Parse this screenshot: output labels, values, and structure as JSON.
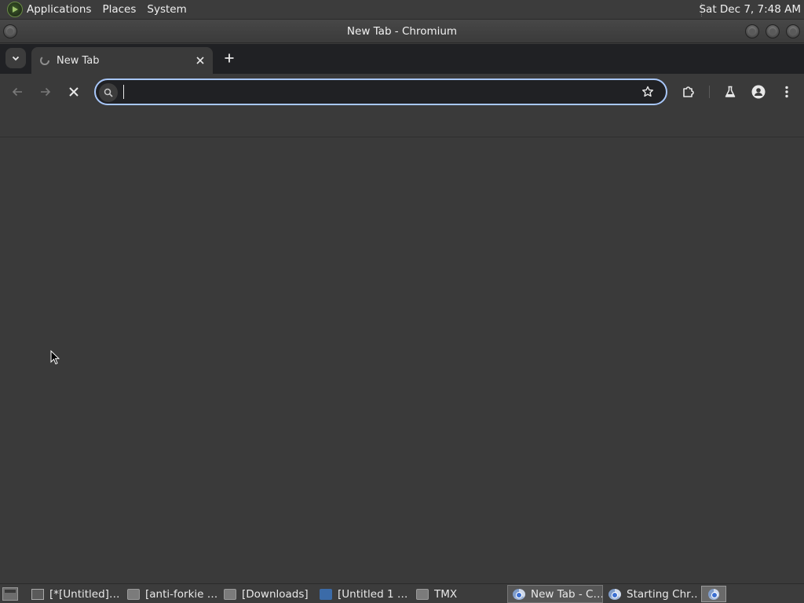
{
  "top_panel": {
    "menus": [
      "Applications",
      "Places",
      "System"
    ],
    "clock": "Sat Dec 7,  7:48 AM"
  },
  "window": {
    "title": "New Tab - Chromium"
  },
  "tabs": [
    {
      "title": "New Tab",
      "icon": "loading-favicon-icon"
    }
  ],
  "toolbar": {
    "omnibox_value": "",
    "icons": [
      "back-icon",
      "forward-icon",
      "stop-icon",
      "search-icon",
      "bookmark-star-icon",
      "extensions-icon",
      "labs-flask-icon",
      "profile-icon",
      "menu-dots-icon"
    ]
  },
  "taskbar": {
    "items": [
      {
        "label": "[*[Untitled]…",
        "icon": "document-icon",
        "active": false
      },
      {
        "label": "[anti-forkie …",
        "icon": "folder-icon",
        "active": false
      },
      {
        "label": "[Downloads]",
        "icon": "folder-icon",
        "active": false
      },
      {
        "label": "[Untitled 1 …",
        "icon": "writer-icon",
        "active": false
      },
      {
        "label": "TMX",
        "icon": "folder-icon",
        "active": false
      },
      {
        "label": "New Tab - C…",
        "icon": "chromium-icon",
        "active": true
      },
      {
        "label": "Starting Chr…",
        "icon": "chromium-icon",
        "active": false
      }
    ]
  },
  "colors": {
    "panel_bg": "#3c3c3c",
    "tabstrip_bg": "#202124",
    "content_bg": "#3a3a3a",
    "omnibox_focus": "#a8c7fa"
  }
}
